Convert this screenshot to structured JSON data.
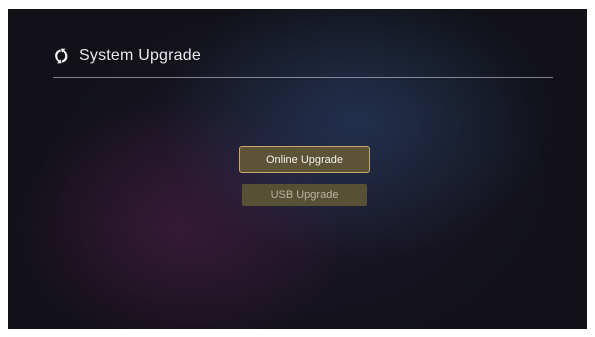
{
  "header": {
    "icon": "upgrade-icon",
    "title": "System Upgrade"
  },
  "menu": {
    "items": [
      {
        "label": "Online Upgrade",
        "focused": true
      },
      {
        "label": "USB Upgrade",
        "focused": false
      }
    ]
  },
  "colors": {
    "focus_border": "#c9a96a",
    "button_fill": "#5d5338"
  }
}
